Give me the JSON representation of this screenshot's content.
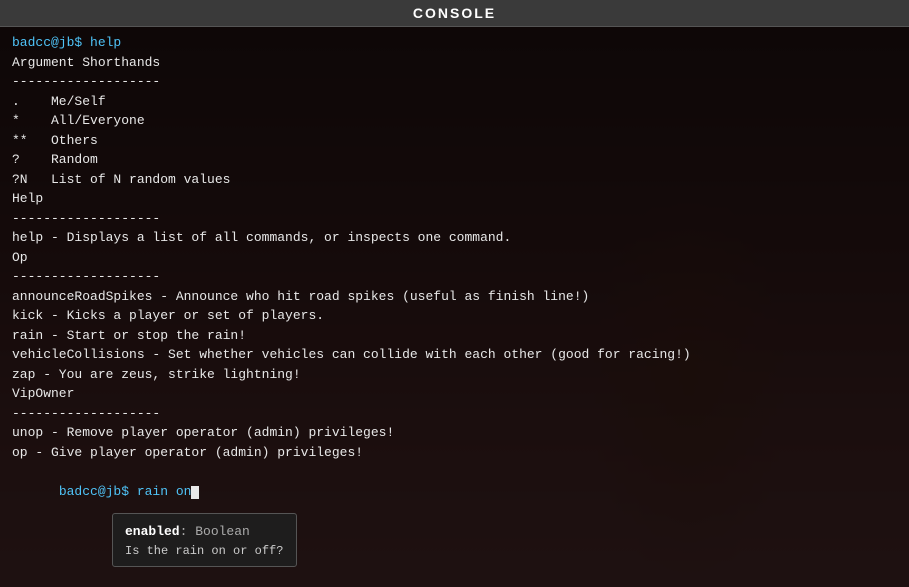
{
  "title": "CONSOLE",
  "console": {
    "lines": [
      {
        "type": "prompt",
        "text": "badcc@jb$ help"
      },
      {
        "type": "output",
        "text": "Argument Shorthands"
      },
      {
        "type": "output",
        "text": "-------------------"
      },
      {
        "type": "output",
        "text": ".    Me/Self"
      },
      {
        "type": "output",
        "text": "*    All/Everyone"
      },
      {
        "type": "output",
        "text": "**   Others"
      },
      {
        "type": "output",
        "text": "?    Random"
      },
      {
        "type": "output",
        "text": "?N   List of N random values"
      },
      {
        "type": "output",
        "text": ""
      },
      {
        "type": "output",
        "text": "Help"
      },
      {
        "type": "output",
        "text": "-------------------"
      },
      {
        "type": "output",
        "text": "help - Displays a list of all commands, or inspects one command."
      },
      {
        "type": "output",
        "text": ""
      },
      {
        "type": "output",
        "text": "Op"
      },
      {
        "type": "output",
        "text": "-------------------"
      },
      {
        "type": "output",
        "text": "announceRoadSpikes - Announce who hit road spikes (useful as finish line!)"
      },
      {
        "type": "output",
        "text": "kick - Kicks a player or set of players."
      },
      {
        "type": "output",
        "text": "rain - Start or stop the rain!"
      },
      {
        "type": "output",
        "text": "vehicleCollisions - Set whether vehicles can collide with each other (good for racing!)"
      },
      {
        "type": "output",
        "text": "zap - You are zeus, strike lightning!"
      },
      {
        "type": "output",
        "text": ""
      },
      {
        "type": "output",
        "text": "VipOwner"
      },
      {
        "type": "output",
        "text": "-------------------"
      },
      {
        "type": "output",
        "text": "unop - Remove player operator (admin) privileges!"
      },
      {
        "type": "output",
        "text": "op - Give player operator (admin) privileges!"
      }
    ],
    "current_prompt": "badcc@jb$ rain on",
    "prompt_prefix": "badcc@jb$ ",
    "prompt_input": "rain on"
  },
  "tooltip": {
    "param_name": "enabled",
    "param_separator": ": ",
    "param_type": "Boolean",
    "description": "Is the rain on or off?"
  }
}
